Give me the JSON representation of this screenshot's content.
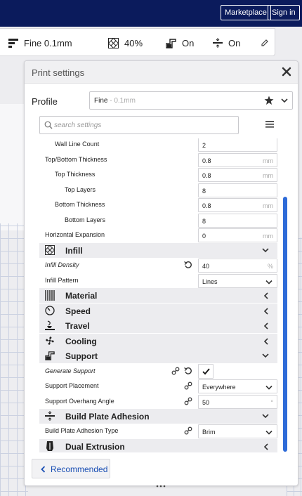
{
  "header": {
    "marketplace_label": "Marketplace",
    "signin_label": "Sign in"
  },
  "quickbar": {
    "profile": {
      "icon": "layer-height-icon",
      "label": "Fine 0.1mm"
    },
    "infill": {
      "icon": "infill-icon",
      "label": "40%"
    },
    "support": {
      "icon": "support-icon",
      "label": "On"
    },
    "adhesion": {
      "icon": "adhesion-icon",
      "label": "On"
    },
    "edit_icon": "pencil-icon"
  },
  "panel": {
    "title": "Print settings",
    "profile_label": "Profile",
    "profile_name": "Fine",
    "profile_sub": " - 0.1mm",
    "search_placeholder": "search settings",
    "recommended_label": "Recommended"
  },
  "settings": {
    "wall_line_count": {
      "label": "Wall Line Count",
      "value": "2"
    },
    "top_bottom_thickness": {
      "label": "Top/Bottom Thickness",
      "value": "0.8",
      "unit": "mm"
    },
    "top_thickness": {
      "label": "Top Thickness",
      "value": "0.8",
      "unit": "mm"
    },
    "top_layers": {
      "label": "Top Layers",
      "value": "8"
    },
    "bottom_thickness": {
      "label": "Bottom Thickness",
      "value": "0.8",
      "unit": "mm"
    },
    "bottom_layers": {
      "label": "Bottom Layers",
      "value": "8"
    },
    "horizontal_expansion": {
      "label": "Horizontal Expansion",
      "value": "0",
      "unit": "mm"
    },
    "infill_density": {
      "label": "Infill Density",
      "value": "40",
      "unit": "%"
    },
    "infill_pattern": {
      "label": "Infill Pattern",
      "value": "Lines"
    },
    "generate_support": {
      "label": "Generate Support",
      "checked": true
    },
    "support_placement": {
      "label": "Support Placement",
      "value": "Everywhere"
    },
    "support_overhang_angle": {
      "label": "Support Overhang Angle",
      "value": "50",
      "unit": "°"
    },
    "build_plate_adhesion_type": {
      "label": "Build Plate Adhesion Type",
      "value": "Brim"
    }
  },
  "categories": {
    "infill": "Infill",
    "material": "Material",
    "speed": "Speed",
    "travel": "Travel",
    "cooling": "Cooling",
    "support": "Support",
    "build_plate_adhesion": "Build Plate Adhesion",
    "dual_extrusion": "Dual Extrusion"
  },
  "colors": {
    "header_bg": "#0b1b5c",
    "accent": "#2e6bd8",
    "category_bg": "#ececef"
  }
}
